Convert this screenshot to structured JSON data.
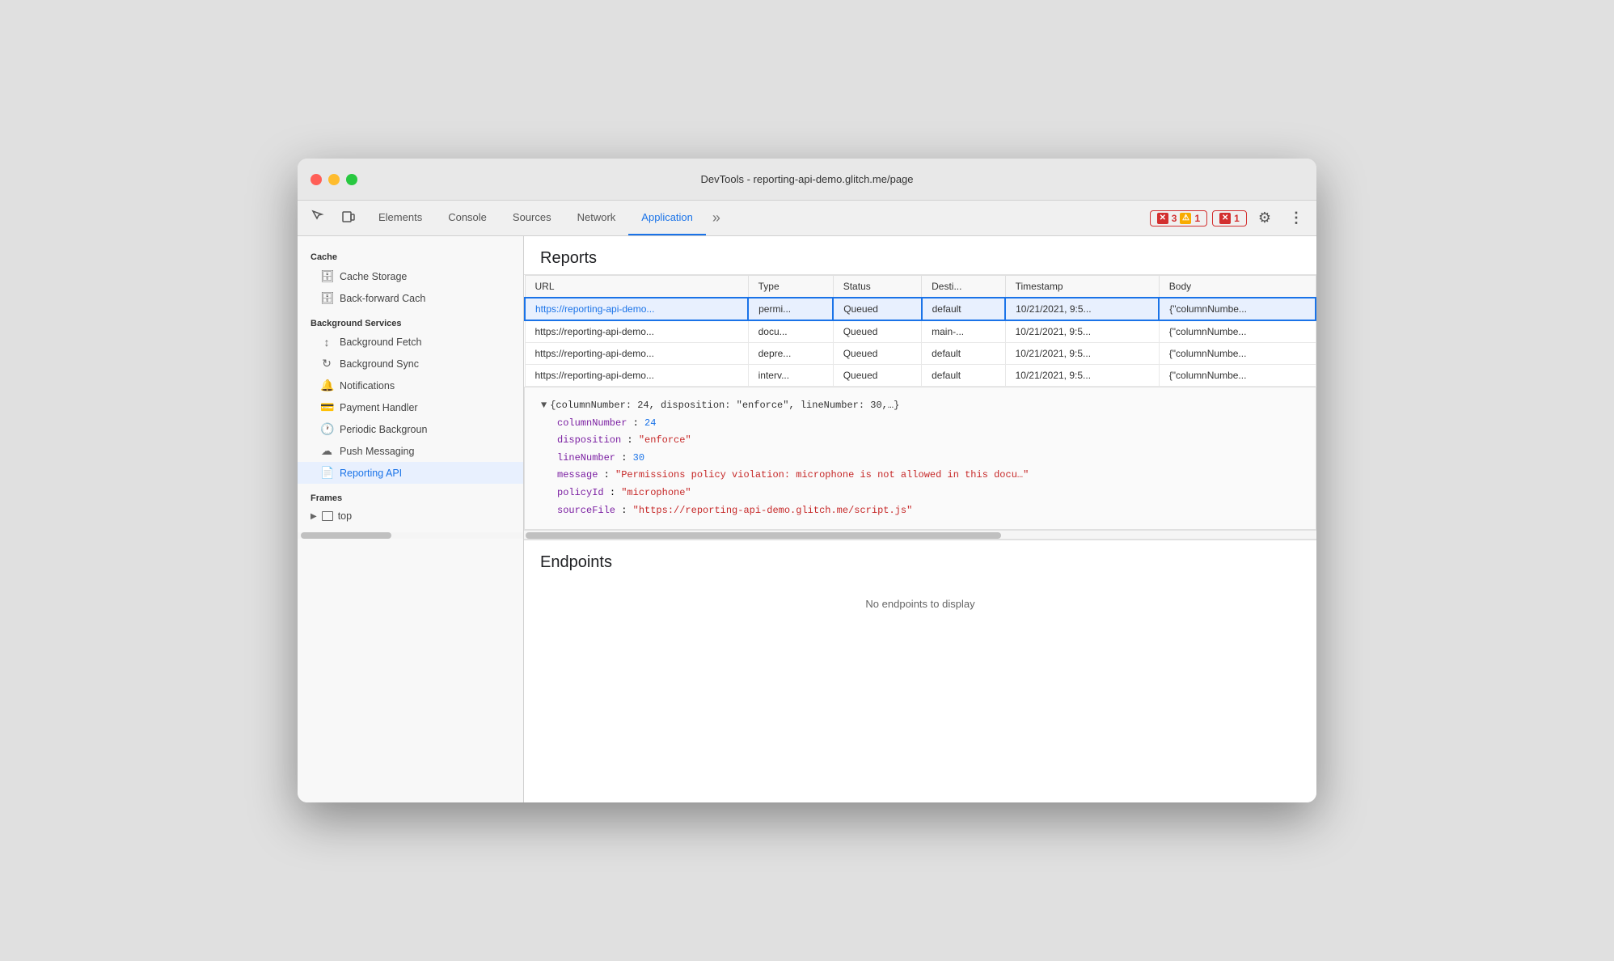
{
  "window": {
    "title": "DevTools - reporting-api-demo.glitch.me/page"
  },
  "tabs": [
    {
      "label": "Elements",
      "active": false
    },
    {
      "label": "Console",
      "active": false
    },
    {
      "label": "Sources",
      "active": false
    },
    {
      "label": "Network",
      "active": false
    },
    {
      "label": "Application",
      "active": true
    }
  ],
  "badges": [
    {
      "type": "red",
      "icon": "✕",
      "count": "3"
    },
    {
      "type": "yellow",
      "icon": "⚠",
      "count": "1"
    },
    {
      "type": "red",
      "icon": "✕",
      "count": "1"
    }
  ],
  "sidebar": {
    "cache_header": "Cache",
    "cache_items": [
      {
        "label": "Cache Storage",
        "icon": "🗄"
      },
      {
        "label": "Back-forward Cach",
        "icon": "🗄"
      }
    ],
    "bg_services_header": "Background Services",
    "bg_items": [
      {
        "label": "Background Fetch",
        "icon": "↕"
      },
      {
        "label": "Background Sync",
        "icon": "↻"
      },
      {
        "label": "Notifications",
        "icon": "🔔"
      },
      {
        "label": "Payment Handler",
        "icon": "💳"
      },
      {
        "label": "Periodic Backgroun",
        "icon": "🕐"
      },
      {
        "label": "Push Messaging",
        "icon": "☁"
      },
      {
        "label": "Reporting API",
        "icon": "📄",
        "active": true
      }
    ],
    "frames_header": "Frames",
    "frames_item": "top"
  },
  "reports": {
    "title": "Reports",
    "columns": [
      "URL",
      "Type",
      "Status",
      "Desti...",
      "Timestamp",
      "Body"
    ],
    "rows": [
      {
        "url": "https://reporting-api-demo...",
        "type": "permi...",
        "status": "Queued",
        "dest": "default",
        "timestamp": "10/21/2021, 9:5...",
        "body": "{\"columnNumbe...",
        "selected": true
      },
      {
        "url": "https://reporting-api-demo...",
        "type": "docu...",
        "status": "Queued",
        "dest": "main-...",
        "timestamp": "10/21/2021, 9:5...",
        "body": "{\"columnNumbe...",
        "selected": false
      },
      {
        "url": "https://reporting-api-demo...",
        "type": "depre...",
        "status": "Queued",
        "dest": "default",
        "timestamp": "10/21/2021, 9:5...",
        "body": "{\"columnNumbe...",
        "selected": false
      },
      {
        "url": "https://reporting-api-demo...",
        "type": "interv...",
        "status": "Queued",
        "dest": "default",
        "timestamp": "10/21/2021, 9:5...",
        "body": "{\"columnNumbe...",
        "selected": false
      }
    ]
  },
  "json_detail": {
    "summary": "{columnNumber: 24, disposition: \"enforce\", lineNumber: 30,…}",
    "props": [
      {
        "key": "columnNumber",
        "value": "24",
        "type": "num"
      },
      {
        "key": "disposition",
        "value": "\"enforce\"",
        "type": "str"
      },
      {
        "key": "lineNumber",
        "value": "30",
        "type": "num"
      },
      {
        "key": "message",
        "value": "\"Permissions policy violation: microphone is not allowed in this docu…\"",
        "type": "str"
      },
      {
        "key": "policyId",
        "value": "\"microphone\"",
        "type": "str"
      },
      {
        "key": "sourceFile",
        "value": "\"https://reporting-api-demo.glitch.me/script.js\"",
        "type": "str"
      }
    ]
  },
  "endpoints": {
    "title": "Endpoints",
    "empty_message": "No endpoints to display"
  }
}
